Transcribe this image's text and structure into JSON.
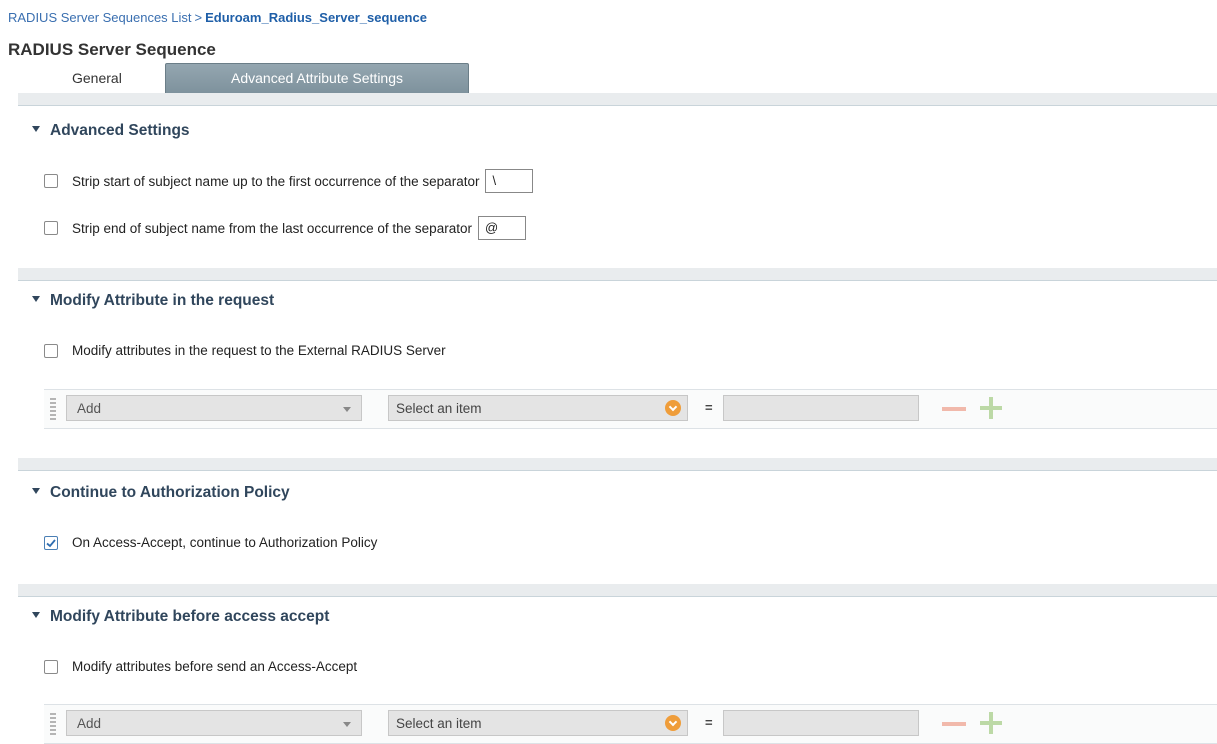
{
  "breadcrumb": {
    "parent": "RADIUS Server Sequences List",
    "separator": ">",
    "current": "Eduroam_Radius_Server_sequence"
  },
  "page_title": "RADIUS Server Sequence",
  "tabs": [
    {
      "label": "General",
      "active": false
    },
    {
      "label": "Advanced Attribute Settings",
      "active": true
    }
  ],
  "sections": {
    "advanced": {
      "title": "Advanced Settings",
      "strip_start": {
        "label": "Strip start of subject name up to the first occurrence of the separator",
        "checked": false,
        "separator": "\\"
      },
      "strip_end": {
        "label": "Strip end of subject name from the last occurrence of the separator",
        "checked": false,
        "separator": "@"
      }
    },
    "modify_request": {
      "title": "Modify Attribute in the request",
      "checkbox": {
        "label": "Modify attributes in the request to the External RADIUS Server",
        "checked": false
      },
      "row": {
        "action": "Add",
        "attribute_placeholder": "Select an item",
        "equals": "=",
        "value": ""
      }
    },
    "continue_authz": {
      "title": "Continue to Authorization Policy",
      "checkbox": {
        "label": "On Access-Accept, continue to Authorization Policy",
        "checked": true
      }
    },
    "modify_accept": {
      "title": "Modify Attribute before access accept",
      "checkbox": {
        "label": "Modify attributes before send an Access-Accept",
        "checked": false
      },
      "row": {
        "action": "Add",
        "attribute_placeholder": "Select an item",
        "equals": "=",
        "value": ""
      }
    }
  },
  "colors": {
    "link": "#3a6fb0",
    "section_title": "#30465c",
    "active_tab": "#879aa4",
    "select_orb": "#ef9d3a",
    "minus_icon": "#f1b9ab",
    "plus_icon": "#bcd9a6"
  },
  "icons": {
    "collapse": "triangle-down-icon",
    "checked": "checkmark-icon",
    "dropdown": "chevron-down-icon",
    "remove": "minus-icon",
    "add": "plus-icon",
    "drag": "drag-handle-icon"
  }
}
